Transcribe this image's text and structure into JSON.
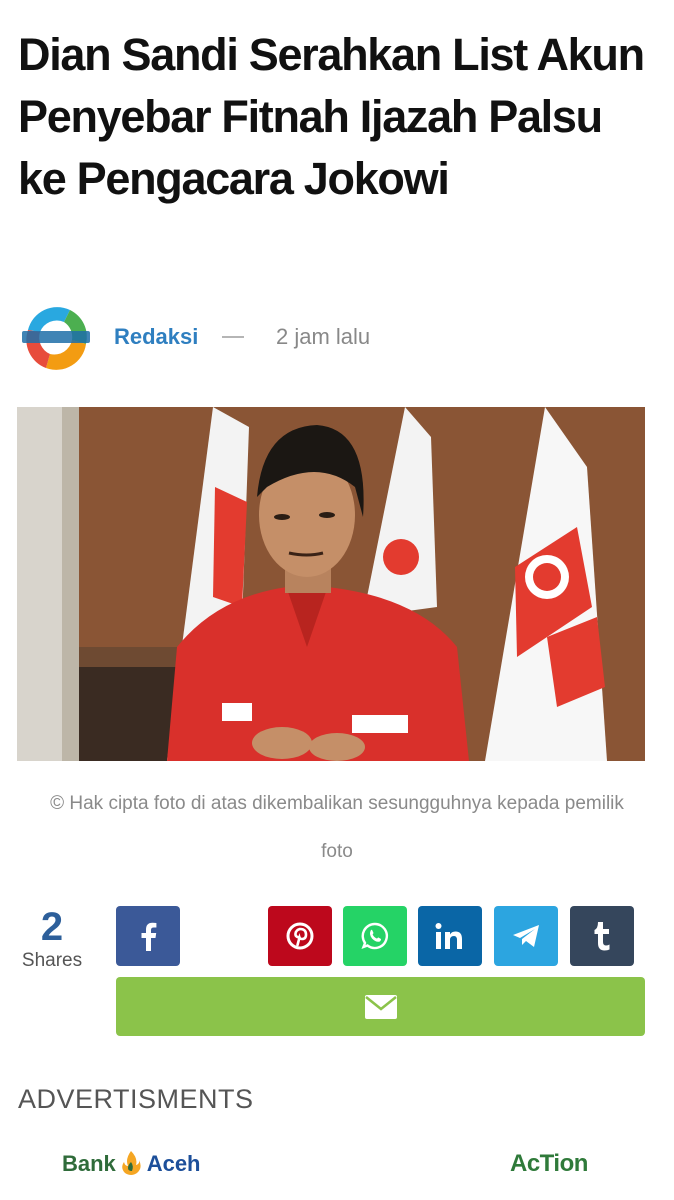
{
  "article": {
    "title": "Dian Sandi Serahkan List Akun Penyebar Fitnah Ijazah Palsu ke Pengacara Jokowi",
    "author": "Redaksi",
    "separator": "—",
    "time": "2 jam lalu",
    "photo_caption": "© Hak cipta foto di atas dikembalikan sesungguhnya kepada pemilik foto"
  },
  "share": {
    "count": "2",
    "label": "Shares",
    "buttons": [
      {
        "network": "facebook",
        "icon": "f",
        "color": "#3b5998"
      },
      {
        "network": "pinterest",
        "icon": "pinterest-icon",
        "color": "#bd081c"
      },
      {
        "network": "whatsapp",
        "icon": "whatsapp-icon",
        "color": "#25d366"
      },
      {
        "network": "linkedin",
        "icon": "in",
        "color": "#0077b5"
      },
      {
        "network": "telegram",
        "icon": "telegram-icon",
        "color": "#2ca5e0"
      },
      {
        "network": "tumblr",
        "icon": "t",
        "color": "#35465c"
      },
      {
        "network": "email",
        "icon": "mail-icon",
        "color": "#8bc34a"
      }
    ]
  },
  "ads": {
    "heading": "ADVERTISMENTS",
    "bank_left": "Bank",
    "bank_right": "Aceh",
    "action_brand": "AcTion"
  }
}
